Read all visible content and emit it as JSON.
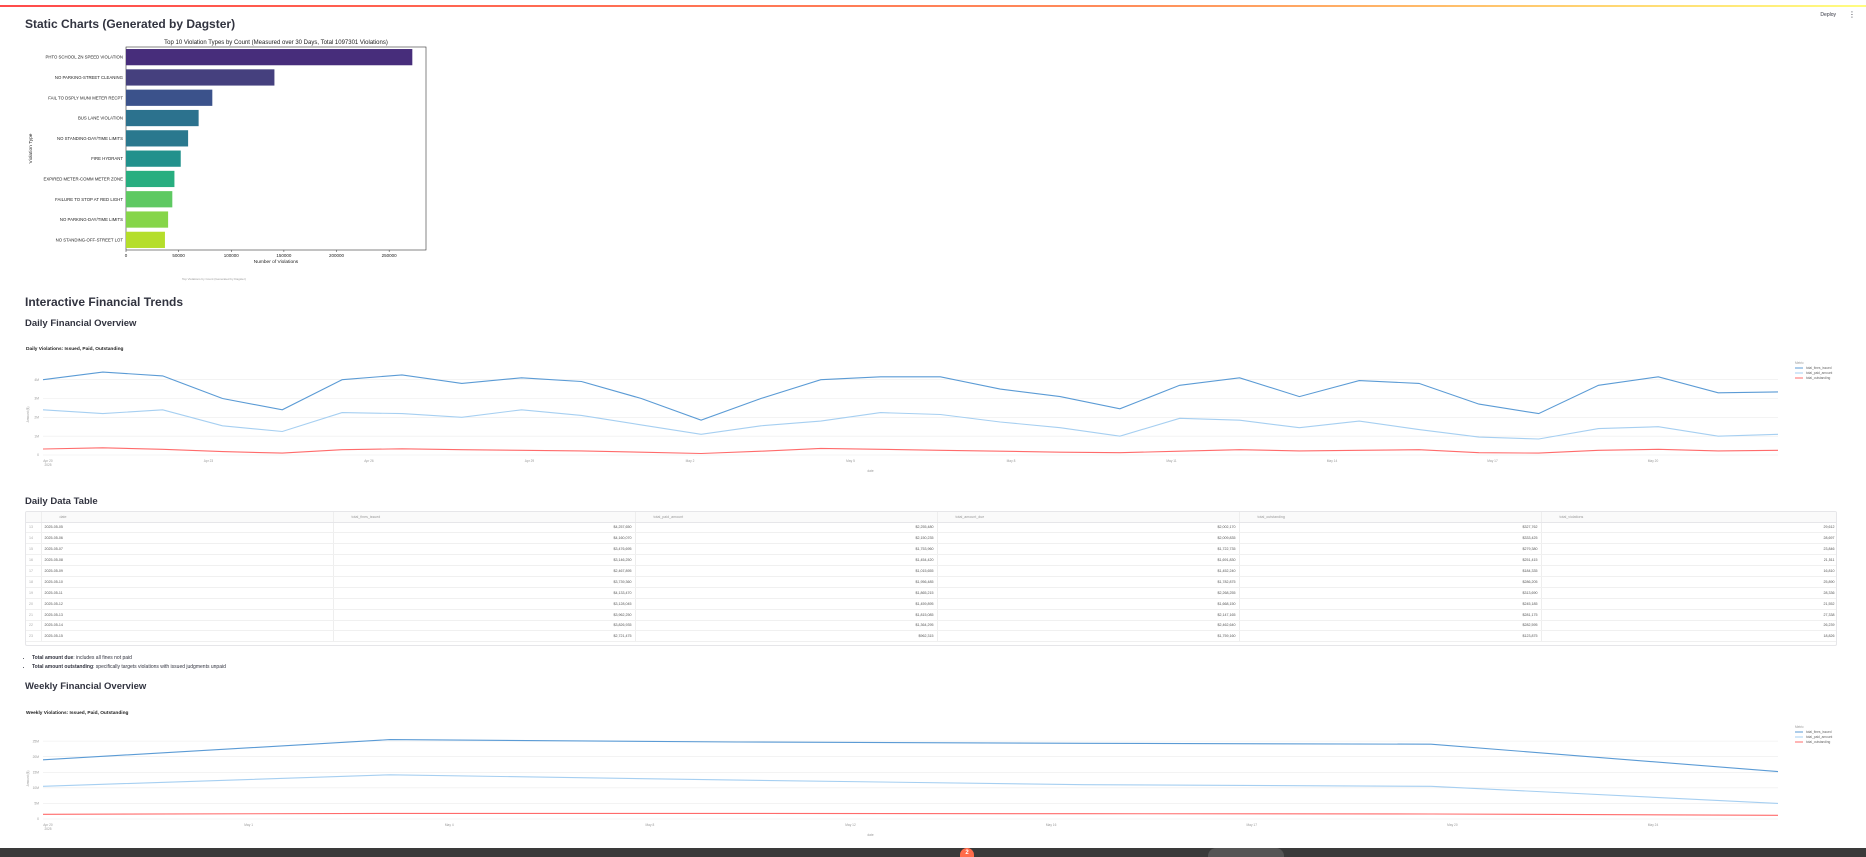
{
  "app": {
    "deploy_label": "Deploy",
    "menu_icon": "kebab-menu-icon"
  },
  "sections": {
    "static_title": "Static Charts (Generated by Dagster)",
    "static_caption": "Top Violations by Count (Generated by Dagster)",
    "interactive_title": "Interactive Financial Trends",
    "daily_title": "Daily Financial Overview",
    "daily_table_title": "Daily Data Table",
    "weekly_title": "Weekly Financial Overview"
  },
  "chart_data": [
    {
      "type": "bar",
      "orientation": "horizontal",
      "title": "Top 10 Violation Types by Count (Measured over 30 Days, Total 1097301 Violations)",
      "xlabel": "Number of Violations",
      "ylabel": "Violation Type",
      "xlim": [
        0,
        285000
      ],
      "xticks": [
        "0",
        "50000",
        "100000",
        "150000",
        "200000",
        "250000"
      ],
      "categories": [
        "PHTO SCHOOL ZN SPEED VIOLATION",
        "NO PARKING-STREET CLEANING",
        "FAIL TO DSPLY MUNI METER RECPT",
        "BUS LANE VIOLATION",
        "NO STANDING-DAY/TIME LIMITS",
        "FIRE HYDRANT",
        "EXPIRED METER-COMM METER ZONE",
        "FAILURE TO STOP AT RED LIGHT",
        "NO PARKING-DAY/TIME LIMITS",
        "NO STANDING-OFF-STREET LOT"
      ],
      "values": [
        272000,
        141000,
        82000,
        69000,
        59000,
        52000,
        46000,
        44000,
        40000,
        37000
      ],
      "colors": [
        "#472d7b",
        "#45407e",
        "#3b528b",
        "#2c728e",
        "#2a788e",
        "#21918c",
        "#28ae80",
        "#5ec962",
        "#86d549",
        "#b5de2b"
      ]
    },
    {
      "type": "line",
      "title": "Daily Violations: Issued, Paid, Outstanding",
      "xlabel": "date",
      "ylabel": "Amount ($)",
      "x": [
        "2025-04-21",
        "2025-04-22",
        "2025-04-23",
        "2025-04-24",
        "2025-04-25",
        "2025-04-26",
        "2025-04-27",
        "2025-04-28",
        "2025-04-29",
        "2025-04-30",
        "2025-05-01",
        "2025-05-02",
        "2025-05-03",
        "2025-05-04",
        "2025-05-05",
        "2025-05-06",
        "2025-05-07",
        "2025-05-08",
        "2025-05-09",
        "2025-05-10",
        "2025-05-11",
        "2025-05-12",
        "2025-05-13",
        "2025-05-14",
        "2025-05-15",
        "2025-05-16",
        "2025-05-17",
        "2025-05-18",
        "2025-05-19",
        "2025-05-20",
        "2025-05-21",
        "2025-05-22"
      ],
      "xticks": [
        "Apr 20\n2025",
        "Apr 23",
        "Apr 26",
        "Apr 29",
        "May 2",
        "May 5",
        "May 8",
        "May 11",
        "May 14",
        "May 17",
        "May 20"
      ],
      "yticks": [
        "0",
        "1M",
        "2M",
        "3M",
        "4M"
      ],
      "ylim": [
        0,
        4.3
      ],
      "legend_title": "Metric",
      "series": [
        {
          "name": "total_fines_issued",
          "color": "#5b9bd5",
          "values": [
            4.0,
            4.4,
            4.2,
            3.0,
            2.4,
            4.0,
            4.25,
            3.8,
            4.1,
            3.9,
            3.0,
            1.85,
            3.0,
            4.0,
            4.15,
            4.15,
            3.5,
            3.1,
            2.45,
            3.7,
            4.1,
            3.1,
            3.95,
            3.8,
            2.7,
            2.2,
            3.7,
            4.15,
            3.3,
            3.35
          ]
        },
        {
          "name": "total_paid_amount",
          "color": "#a6cff1",
          "values": [
            2.4,
            2.2,
            2.4,
            1.55,
            1.25,
            2.25,
            2.2,
            2.0,
            2.4,
            2.1,
            1.6,
            1.1,
            1.55,
            1.8,
            2.25,
            2.15,
            1.75,
            1.45,
            1.0,
            1.95,
            1.85,
            1.45,
            1.8,
            1.35,
            0.95,
            0.85,
            1.4,
            1.5,
            1.0,
            1.1
          ]
        },
        {
          "name": "total_outstanding",
          "color": "#ff6b6b",
          "values": [
            0.32,
            0.38,
            0.3,
            0.18,
            0.1,
            0.28,
            0.33,
            0.28,
            0.25,
            0.22,
            0.15,
            0.08,
            0.2,
            0.35,
            0.3,
            0.25,
            0.2,
            0.15,
            0.12,
            0.2,
            0.28,
            0.22,
            0.25,
            0.28,
            0.12,
            0.1,
            0.25,
            0.3,
            0.22,
            0.25
          ]
        }
      ]
    },
    {
      "type": "line",
      "title": "Weekly Violations: Issued, Paid, Outstanding",
      "xlabel": "date",
      "ylabel": "Amount ($)",
      "x": [
        "2025-04-21",
        "2025-04-28",
        "2025-05-05",
        "2025-05-12",
        "2025-05-19",
        "2025-05-26"
      ],
      "xticks": [
        "Apr 20\n2025",
        "May 1",
        "May 4",
        "May 8",
        "May 12",
        "May 16",
        "May 17",
        "May 20",
        "May 24"
      ],
      "yticks": [
        "0",
        "5M",
        "10M",
        "15M",
        "20M",
        "25M"
      ],
      "ylim": [
        0,
        26
      ],
      "legend_title": "Metric",
      "series": [
        {
          "name": "total_fines_issued",
          "color": "#5b9bd5",
          "values": [
            19.0,
            25.5,
            24.7,
            24.3,
            24.0,
            15.2
          ]
        },
        {
          "name": "total_paid_amount",
          "color": "#a6cff1",
          "values": [
            10.5,
            14.2,
            12.5,
            11.0,
            10.5,
            5.0
          ]
        },
        {
          "name": "total_outstanding",
          "color": "#ff6b6b",
          "values": [
            1.5,
            1.8,
            1.8,
            1.7,
            1.6,
            1.2
          ]
        }
      ]
    }
  ],
  "daily_table": {
    "columns": [
      "date",
      "total_fines_issued",
      "total_paid_amount",
      "total_amount_due",
      "total_outstanding",
      "total_violations"
    ],
    "rows": [
      [
        "13",
        "2025-05-05",
        "$4,257,650",
        "$2,255,480",
        "$2,002,170",
        "$327,762",
        "29,612"
      ],
      [
        "14",
        "2025-05-06",
        "$4,160,070",
        "$2,150,235",
        "$2,009,835",
        "$333,425",
        "28,697"
      ],
      [
        "15",
        "2025-05-07",
        "$3,476,695",
        "$1,753,960",
        "$1,722,735",
        "$279,380",
        "23,846"
      ],
      [
        "16",
        "2025-05-08",
        "$3,146,250",
        "$1,454,420",
        "$1,691,830",
        "$251,415",
        "21,511"
      ],
      [
        "17",
        "2025-05-09",
        "$2,467,895",
        "$1,015,655",
        "$1,452,240",
        "$184,335",
        "16,810"
      ],
      [
        "18",
        "2025-05-10",
        "$3,739,360",
        "$1,956,485",
        "$1,782,875",
        "$286,205",
        "25,890"
      ],
      [
        "19",
        "2025-05-11",
        "$4,133,470",
        "$1,865,215",
        "$2,268,255",
        "$313,690",
        "28,336"
      ],
      [
        "20",
        "2025-05-12",
        "$3,128,045",
        "$1,459,895",
        "$1,668,150",
        "$245,185",
        "21,552"
      ],
      [
        "21",
        "2025-05-13",
        "$3,962,250",
        "$1,815,085",
        "$2,147,165",
        "$281,175",
        "27,338"
      ],
      [
        "22",
        "2025-05-14",
        "$3,826,935",
        "$1,364,295",
        "$2,462,640",
        "$282,595",
        "26,239"
      ],
      [
        "23",
        "2025-05-15",
        "$2,721,475",
        "$962,315",
        "$1,759,160",
        "$123,875",
        "18,826"
      ]
    ]
  },
  "notes": [
    {
      "label": "Total amount due",
      "text": ": includes all fines not paid"
    },
    {
      "label": "Total amount outstanding",
      "text": ": specifically targets violations with issued judgments unpaid"
    }
  ],
  "footer": {
    "badge": "2"
  }
}
